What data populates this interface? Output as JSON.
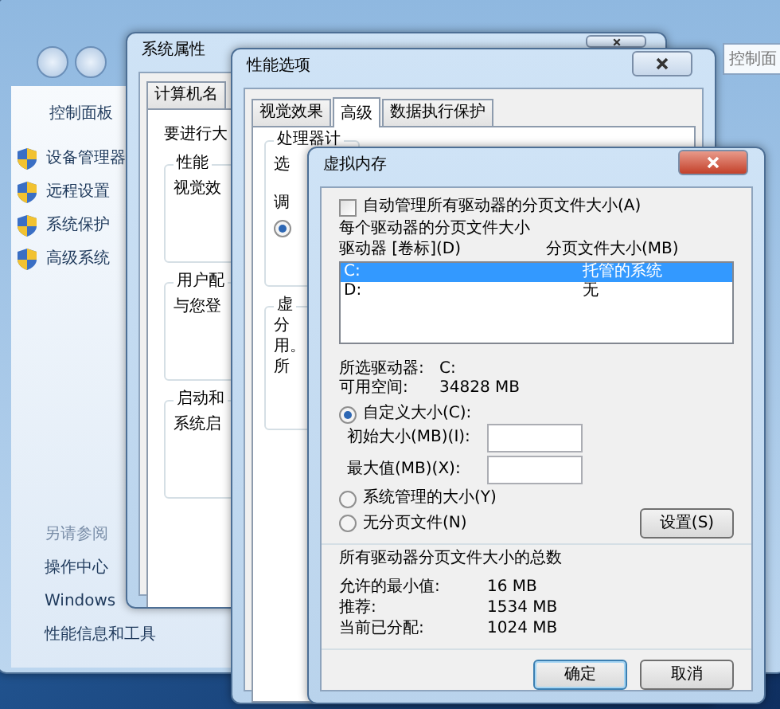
{
  "control_panel": {
    "search_placeholder": "控制面",
    "home_link": "控制面板",
    "tasks": [
      "设备管理器",
      "远程设置",
      "系统保护",
      "高级系统"
    ],
    "see_also_heading": "另请参阅",
    "see_also": [
      "操作中心",
      "Windows",
      "性能信息和工具"
    ]
  },
  "system_properties": {
    "title": "系统属性",
    "tabs": [
      {
        "label": "计算机名",
        "selected": false
      }
    ],
    "intro": "要进行大",
    "groups": [
      {
        "title": "性能",
        "lines": [
          "视觉效"
        ]
      },
      {
        "title": "用户配",
        "lines": [
          "与您登"
        ]
      },
      {
        "title": "启动和",
        "lines": [
          "系统启"
        ]
      }
    ]
  },
  "performance_options": {
    "title": "性能选项",
    "tabs": [
      {
        "label": "视觉效果",
        "selected": false
      },
      {
        "label": "高级",
        "selected": true
      },
      {
        "label": "数据执行保护",
        "selected": false
      }
    ],
    "groups": [
      {
        "title": "处理器计",
        "lines": [
          "选",
          "调"
        ],
        "radio_checked": true
      },
      {
        "title": "虚",
        "lines": [
          "分",
          "用。",
          "所"
        ]
      }
    ]
  },
  "virtual_memory": {
    "title": "虚拟内存",
    "auto_manage": {
      "label": "自动管理所有驱动器的分页文件大小(A)",
      "checked": false
    },
    "per_drive_heading": "每个驱动器的分页文件大小",
    "columns": [
      "驱动器 [卷标](D)",
      "分页文件大小(MB)"
    ],
    "drives": [
      {
        "drive": "C:",
        "size": "托管的系统",
        "selected": true
      },
      {
        "drive": "D:",
        "size": "无",
        "selected": false
      }
    ],
    "selected_drive": {
      "label": "所选驱动器:",
      "value": "C:"
    },
    "free_space": {
      "label": "可用空间:",
      "value": "34828 MB"
    },
    "options": [
      {
        "label": "自定义大小(C):",
        "selected": true
      },
      {
        "label": "系统管理的大小(Y)",
        "selected": false
      },
      {
        "label": "无分页文件(N)",
        "selected": false
      }
    ],
    "initial_size": {
      "label": "初始大小(MB)(I):"
    },
    "maximum_size": {
      "label": "最大值(MB)(X):"
    },
    "set_button": "设置(S)",
    "totals_heading": "所有驱动器分页文件大小的总数",
    "totals": [
      {
        "label": "允许的最小值:",
        "value": "16 MB"
      },
      {
        "label": "推荐:",
        "value": "1534 MB"
      },
      {
        "label": "当前已分配:",
        "value": "1024 MB"
      }
    ],
    "buttons": [
      "确定",
      "取消"
    ]
  }
}
